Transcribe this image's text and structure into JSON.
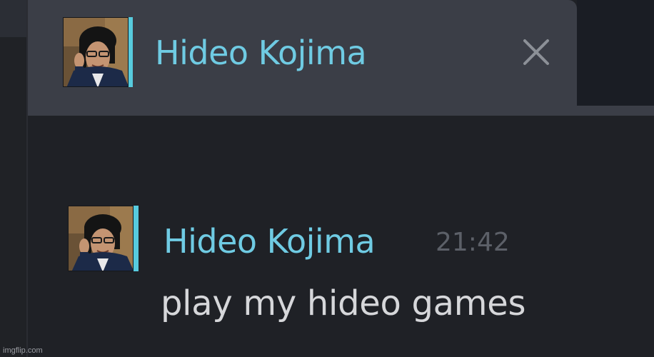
{
  "watermark": "imgflip.com",
  "chat_tab": {
    "name": "Hideo Kojima",
    "close_icon": "close-icon",
    "status_color": "#57cbde",
    "name_color": "#6fcbe3"
  },
  "message": {
    "sender": "Hideo Kojima",
    "time": "21:42",
    "text": "play my hideo games"
  }
}
